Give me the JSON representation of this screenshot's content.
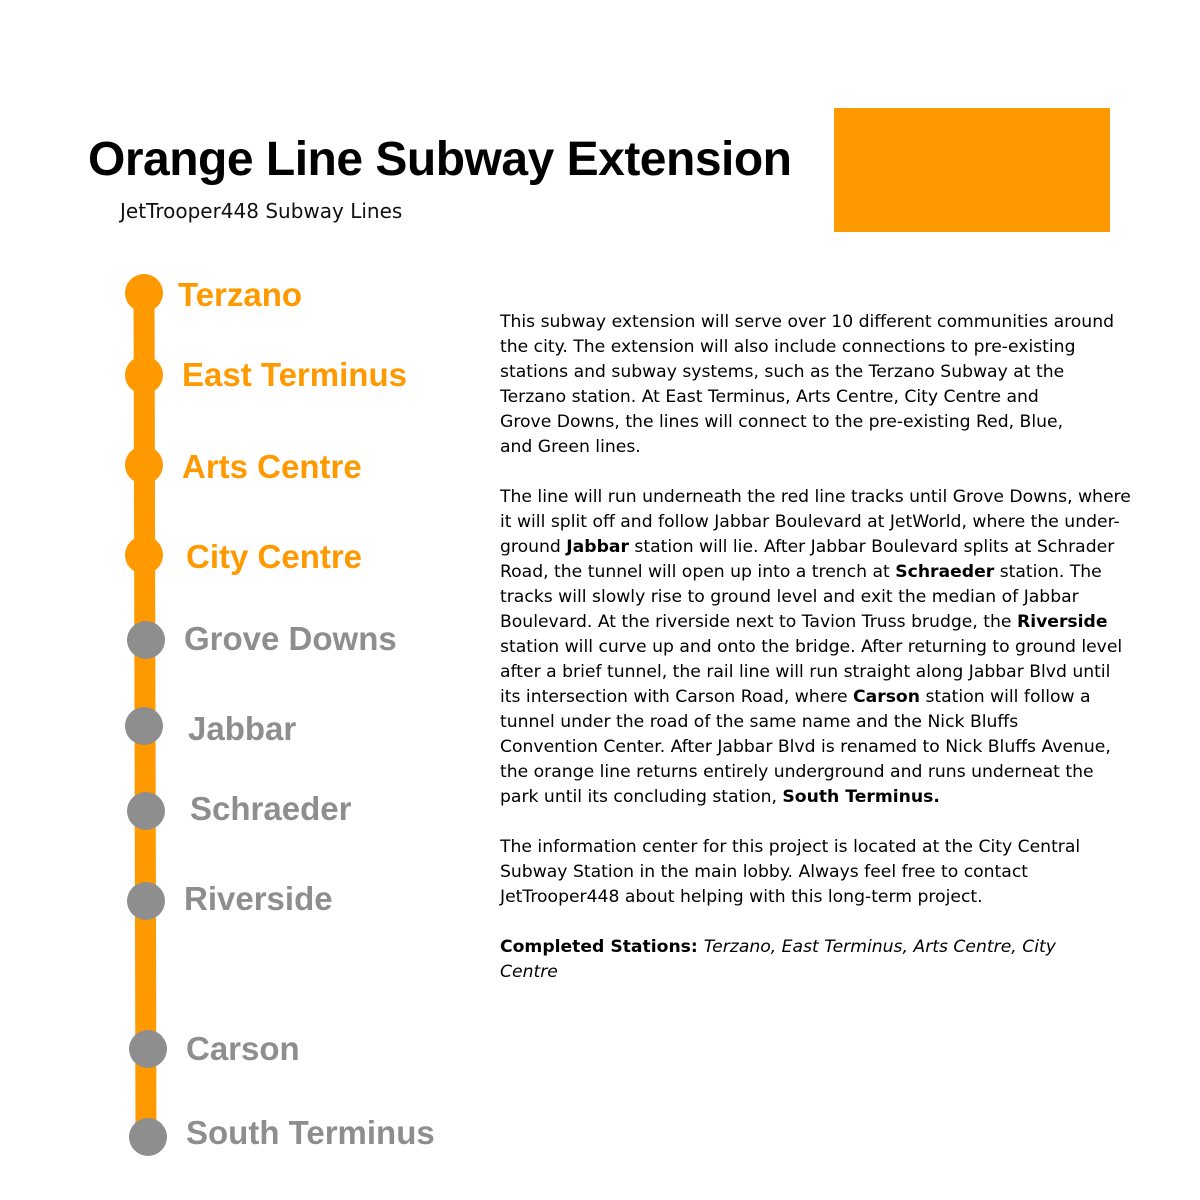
{
  "title": "Orange Line Subway Extension",
  "subtitle": "JetTrooper448 Subway Lines",
  "colors": {
    "line": "#FF9900",
    "completed": "#FF9900",
    "planned": "#8E8E8E",
    "text": "#000000"
  },
  "stations": [
    {
      "name": "Terzano",
      "status": "completed"
    },
    {
      "name": "East Terminus",
      "status": "completed"
    },
    {
      "name": "Arts Centre",
      "status": "completed"
    },
    {
      "name": "City Centre",
      "status": "completed"
    },
    {
      "name": "Grove Downs",
      "status": "planned"
    },
    {
      "name": "Jabbar",
      "status": "planned"
    },
    {
      "name": "Schraeder",
      "status": "planned"
    },
    {
      "name": "Riverside",
      "status": "planned"
    },
    {
      "name": "Carson",
      "status": "planned"
    },
    {
      "name": "South Terminus",
      "status": "planned"
    }
  ],
  "description": {
    "p1": {
      "l1": "This subway extension will serve over 10 different communities around",
      "l2": "the city. The extension will also include connections to pre-existing",
      "l3": "stations and subway systems, such as the Terzano Subway at the",
      "l4": "Terzano station. At East Terminus, Arts Centre, City Centre and",
      "l5": "Grove Downs, the lines will connect to the pre-existing Red, Blue,",
      "l6": "and Green lines."
    },
    "p2": {
      "l1": "The line will run underneath the red line tracks until Grove Downs, where",
      "l2": "it will split off and follow Jabbar Boulevard at JetWorld, where the under-",
      "l3a": "ground ",
      "l3b": "Jabbar",
      "l3c": " station will lie. After Jabbar Boulevard splits at Schrader",
      "l4a": "Road, the tunnel will open up into a trench at ",
      "l4b": "Schraeder",
      "l4c": " station. The",
      "l5": "tracks will slowly rise to ground level and exit the median of Jabbar",
      "l6": "Boulevard. At the riverside next to Tavion Truss brudge, the ",
      "l6b": "Riverside",
      "l7": "station will curve up and onto the bridge. After returning to ground level",
      "l8": "after a brief tunnel, the rail line will run straight along Jabbar Blvd until",
      "l9a": "its intersection with Carson Road, where ",
      "l9b": "Carson",
      "l9c": " station will follow a",
      "l10": "tunnel under the road of the same name and the Nick Bluffs",
      "l11": "Convention Center. After Jabbar Blvd is renamed to Nick Bluffs Avenue,",
      "l12": "the orange line returns entirely underground and runs underneat the",
      "l13a": "park until its concluding station, ",
      "l13b": "South Terminus."
    },
    "p3": {
      "l1": "The information center for this project is located at the City Central",
      "l2": "Subway Station in the main lobby. Always feel free to contact",
      "l3": "JetTrooper448 about helping with this long-term project."
    },
    "p4": {
      "label": "Completed Stations: ",
      "l1": "Terzano, East Terminus, Arts Centre, City",
      "l2": "Centre"
    }
  }
}
